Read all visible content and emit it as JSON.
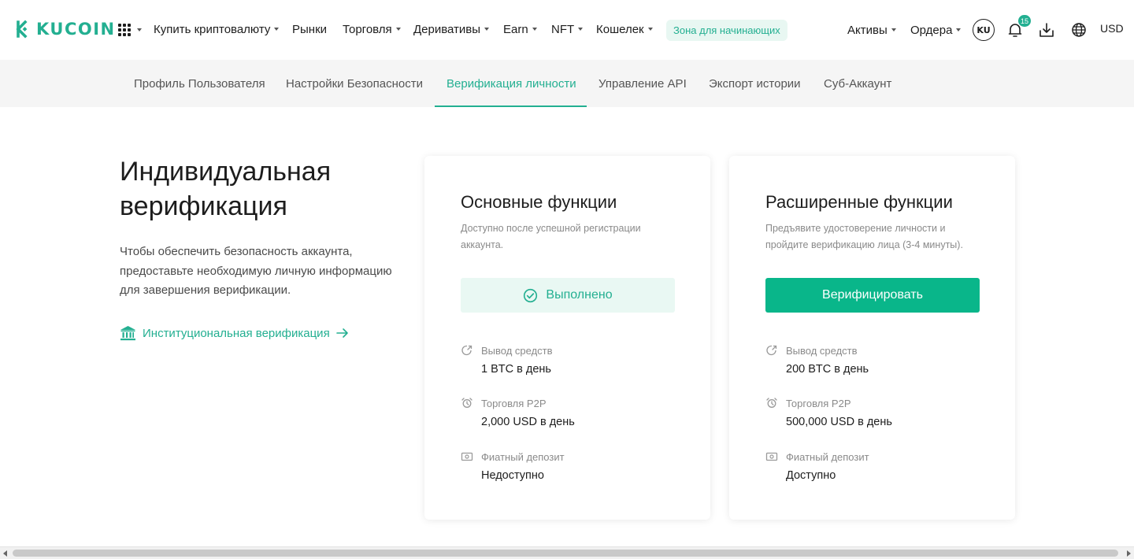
{
  "brand": {
    "name": "KUCOIN",
    "color": "#23af91"
  },
  "topnav": {
    "apps_icon": "grid-icon",
    "menu": [
      {
        "label": "Купить криптовалюту",
        "dropdown": true
      },
      {
        "label": "Рынки",
        "dropdown": false
      },
      {
        "label": "Торговля",
        "dropdown": true
      },
      {
        "label": "Деривативы",
        "dropdown": true
      },
      {
        "label": "Earn",
        "dropdown": true
      },
      {
        "label": "NFT",
        "dropdown": true
      },
      {
        "label": "Кошелек",
        "dropdown": true
      }
    ],
    "beginner_zone": "Зона для начинающих",
    "assets": "Активы",
    "orders": "Ордера",
    "avatar": "KU",
    "notifications_count": "15",
    "currency": "USD"
  },
  "subnav": {
    "tabs": [
      {
        "label": "Профиль Пользователя",
        "active": false
      },
      {
        "label": "Настройки Безопасности",
        "active": false
      },
      {
        "label": "Верификация личности",
        "active": true
      },
      {
        "label": "Управление API",
        "active": false
      },
      {
        "label": "Экспорт истории",
        "active": false
      },
      {
        "label": "Суб-Аккаунт",
        "active": false
      }
    ]
  },
  "hero": {
    "title_line1": "Индивидуальная",
    "title_line2": "верификация",
    "description": "Чтобы обеспечить безопасность аккаунта, предоставьте необходимую личную информацию для завершения верификации.",
    "institutional_link": "Институциональная верификация"
  },
  "cards": [
    {
      "title": "Основные функции",
      "description": "Доступно после успешной регистрации аккаунта.",
      "status": "Выполнено",
      "features": [
        {
          "label": "Вывод средств",
          "value": "1 BTC в день",
          "icon": "withdraw-icon"
        },
        {
          "label": "Торговля P2P",
          "value": "2,000 USD в день",
          "icon": "p2p-icon"
        },
        {
          "label": "Фиатный депозит",
          "value": "Недоступно",
          "icon": "fiat-deposit-icon"
        }
      ]
    },
    {
      "title": "Расширенные функции",
      "description": "Предъявите удостоверение личности и пройдите верификацию лица (3-4 минуты).",
      "action": "Верифицировать",
      "features": [
        {
          "label": "Вывод средств",
          "value": "200 BTC в день",
          "icon": "withdraw-icon"
        },
        {
          "label": "Торговля P2P",
          "value": "500,000 USD в день",
          "icon": "p2p-icon"
        },
        {
          "label": "Фиатный депозит",
          "value": "Доступно",
          "icon": "fiat-deposit-icon"
        }
      ]
    }
  ],
  "colors": {
    "accent": "#23af91",
    "button": "#09b68a",
    "muted": "#8a8a8a"
  }
}
